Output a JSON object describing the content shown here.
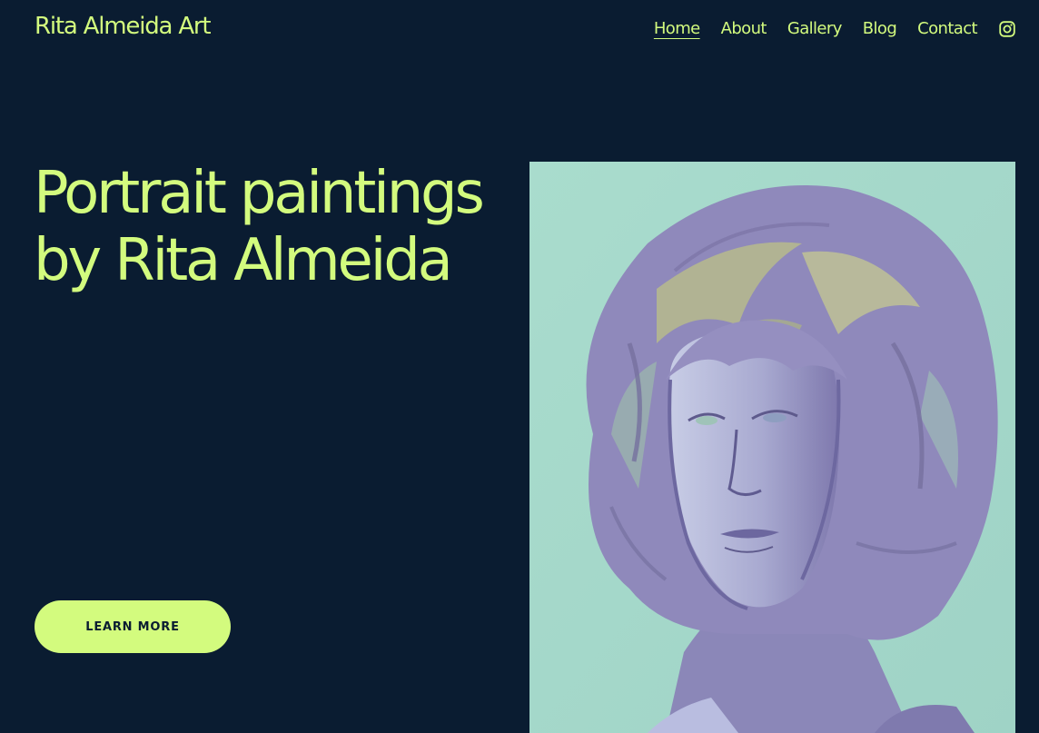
{
  "site": {
    "title": "Rita Almeida Art"
  },
  "nav": {
    "items": [
      {
        "label": "Home",
        "active": true
      },
      {
        "label": "About"
      },
      {
        "label": "Gallery"
      },
      {
        "label": "Blog"
      },
      {
        "label": "Contact"
      }
    ],
    "social_icon": "instagram-icon"
  },
  "hero": {
    "heading_line1": "Portrait paintings",
    "heading_line2": "by Rita Almeida",
    "cta_label": "LEARN MORE"
  },
  "colors": {
    "background": "#0a1c31",
    "accent": "#d3fb7e",
    "painting_background": "#a7d8cb",
    "painting_figure": "#8a86b8"
  }
}
